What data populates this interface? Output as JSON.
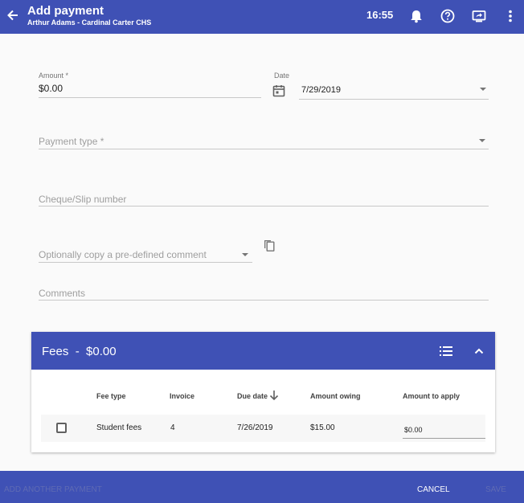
{
  "header": {
    "title": "Add payment",
    "subtitle": "Arthur Adams - Cardinal Carter CHS",
    "time": "16:55",
    "icons": [
      "arrow-back-icon",
      "bell-icon",
      "help-icon",
      "screen-share-icon",
      "more-vert-icon"
    ]
  },
  "form": {
    "amount_label": "Amount *",
    "amount_value": "$0.00",
    "date_label": "Date",
    "date_value": "7/29/2019",
    "payment_type_placeholder": "Payment type *",
    "cheque_placeholder": "Cheque/Slip number",
    "comment_template_placeholder": "Optionally copy a pre-defined comment",
    "comments_placeholder": "Comments"
  },
  "fees": {
    "title": "Fees",
    "separator": "-",
    "total": "$0.00",
    "columns": [
      "Fee type",
      "Invoice",
      "Due date",
      "Amount owing",
      "Amount to apply"
    ],
    "rows": [
      {
        "fee_type": "Student fees",
        "invoice": "4",
        "due_date": "7/26/2019",
        "amount_owing": "$15.00",
        "amount_to_apply": "$0.00"
      }
    ]
  },
  "footer": {
    "add_another": "ADD ANOTHER PAYMENT",
    "cancel": "CANCEL",
    "save": "SAVE"
  },
  "colors": {
    "primary": "#3f51b5",
    "background": "#fafafa",
    "disabled_text": "#5f6bb4"
  }
}
